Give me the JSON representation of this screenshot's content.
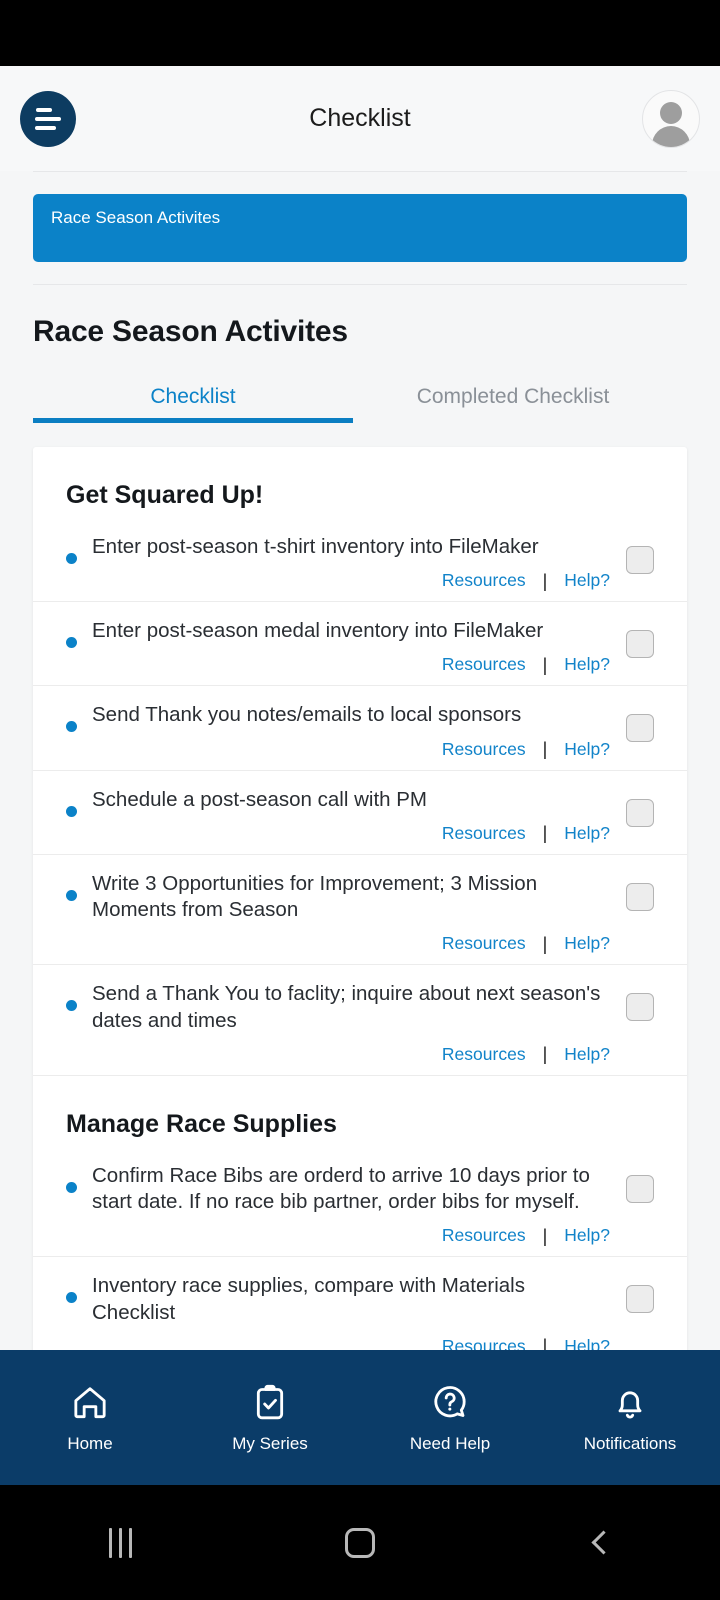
{
  "header": {
    "title": "Checklist",
    "menu_icon": "hamburger-menu-icon",
    "avatar_icon": "user-avatar-icon"
  },
  "breadcrumb": {
    "label": "Race Season Activites"
  },
  "page": {
    "title": "Race Season Activites"
  },
  "tabs": [
    {
      "label": "Checklist",
      "active": true
    },
    {
      "label": "Completed Checklist",
      "active": false
    }
  ],
  "actions": {
    "resources_label": "Resources",
    "help_label": "Help?",
    "separator": "|"
  },
  "sections": [
    {
      "title": "Get Squared Up!",
      "items": [
        {
          "text": "Enter post-season t-shirt inventory into FileMaker",
          "checked": false
        },
        {
          "text": "Enter post-season medal inventory into FileMaker",
          "checked": false
        },
        {
          "text": "Send Thank you notes/emails to local sponsors",
          "checked": false
        },
        {
          "text": "Schedule a post-season call with PM",
          "checked": false
        },
        {
          "text": "Write 3 Opportunities for Improvement; 3 Mission Moments from Season",
          "checked": false
        },
        {
          "text": "Send a Thank You to faclity; inquire about next season's dates and times",
          "checked": false
        }
      ]
    },
    {
      "title": "Manage Race Supplies",
      "items": [
        {
          "text": "Confirm Race Bibs are orderd to arrive 10 days prior to start date. If no race bib partner, order bibs for myself.",
          "checked": false
        },
        {
          "text": "Inventory race supplies, compare with Materials Checklist",
          "checked": false
        }
      ]
    }
  ],
  "bottom_nav": [
    {
      "label": "Home",
      "icon": "home-icon"
    },
    {
      "label": "My Series",
      "icon": "clipboard-check-icon"
    },
    {
      "label": "Need Help",
      "icon": "question-circle-icon"
    },
    {
      "label": "Notifications",
      "icon": "bell-icon"
    }
  ],
  "system_nav": {
    "recents": "recents-icon",
    "home": "home-square-icon",
    "back": "back-chevron-icon"
  },
  "colors": {
    "brand_dark": "#0b3c68",
    "accent_blue": "#0b82c8",
    "link_blue": "#1183c9",
    "page_bg": "#f5f6f7"
  }
}
